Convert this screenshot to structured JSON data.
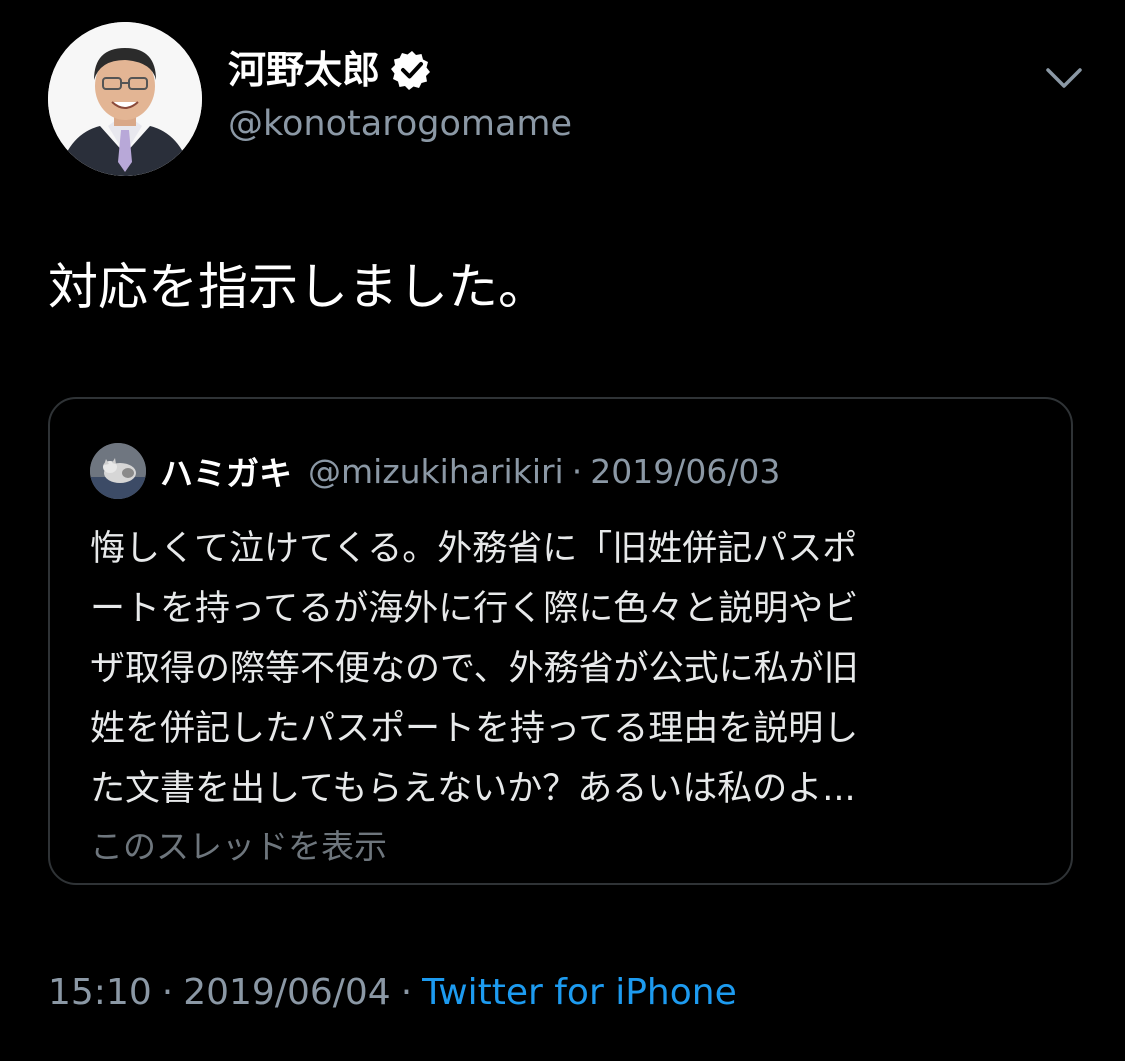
{
  "author": {
    "display_name": "河野太郎",
    "handle": "@konotarogomame"
  },
  "tweet": {
    "text": "対応を指示しました。",
    "time": "15:10",
    "separator": "·",
    "date": "2019/06/04",
    "source": "Twitter for iPhone"
  },
  "quoted": {
    "display_name": "ハミガキ",
    "handle": "@mizukiharikiri",
    "separator": "·",
    "date": "2019/06/03",
    "lines": [
      "悔しくて泣けてくる。外務省に「旧姓併記パスポ",
      "ートを持ってるが海外に行く際に色々と説明やビ",
      "ザ取得の際等不便なので、外務省が公式に私が旧",
      "姓を併記したパスポートを持ってる理由を説明し",
      "た文書を出してもらえないか？あるいは私のよ..."
    ],
    "show_thread": "このスレッドを表示"
  },
  "icons": {
    "verified": "verified-badge-icon",
    "menu": "chevron-down-icon"
  },
  "colors": {
    "background": "#000000",
    "primary_text": "#ffffff",
    "secondary_text": "#8b98a5",
    "link": "#1d9bf0",
    "border": "#2f3336"
  }
}
